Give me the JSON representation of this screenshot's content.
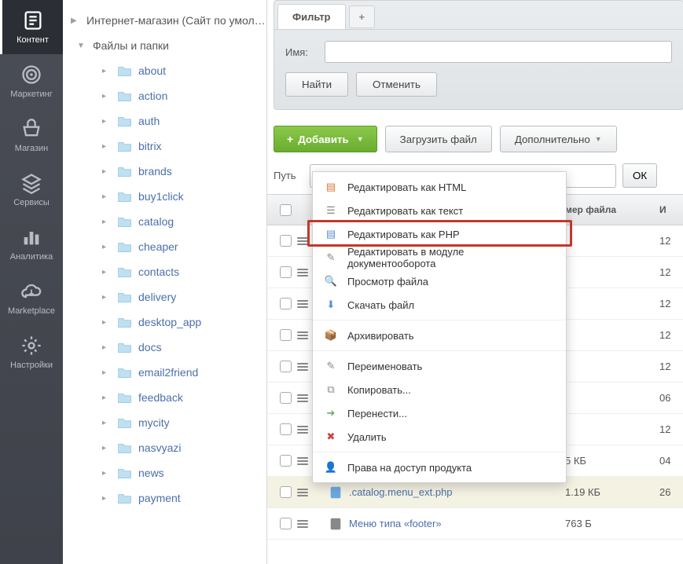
{
  "sidebar": [
    {
      "id": "content",
      "label": "Контент",
      "icon": "doc"
    },
    {
      "id": "marketing",
      "label": "Маркетинг",
      "icon": "target"
    },
    {
      "id": "shop",
      "label": "Магазин",
      "icon": "basket"
    },
    {
      "id": "services",
      "label": "Сервисы",
      "icon": "stack"
    },
    {
      "id": "analytics",
      "label": "Аналитика",
      "icon": "bars"
    },
    {
      "id": "marketplace",
      "label": "Marketplace",
      "icon": "cloud"
    },
    {
      "id": "settings",
      "label": "Настройки",
      "icon": "gear"
    }
  ],
  "tree": {
    "root1": "Интернет-магазин (Сайт по умол…",
    "root2": "Файлы и папки",
    "folders": [
      "about",
      "action",
      "auth",
      "bitrix",
      "brands",
      "buy1click",
      "catalog",
      "cheaper",
      "contacts",
      "delivery",
      "desktop_app",
      "docs",
      "email2friend",
      "feedback",
      "mycity",
      "nasvyazi",
      "news",
      "payment"
    ]
  },
  "filter": {
    "tab": "Фильтр",
    "add": "+",
    "name_label": "Имя:",
    "find": "Найти",
    "cancel": "Отменить"
  },
  "toolbar": {
    "add": "Добавить",
    "upload": "Загрузить файл",
    "more": "Дополнительно"
  },
  "path": {
    "label": "Путь",
    "ok": "ОК"
  },
  "table": {
    "header_size": "мер файла",
    "header_last": "И"
  },
  "rows": [
    {
      "size": "",
      "date": "12"
    },
    {
      "size": "",
      "date": "12"
    },
    {
      "size": "",
      "date": "12"
    },
    {
      "size": "",
      "date": "12"
    },
    {
      "size": "",
      "date": "12"
    },
    {
      "size": "",
      "date": "06"
    },
    {
      "size": "",
      "date": "12"
    },
    {
      "size": "5 КБ",
      "date": "04"
    }
  ],
  "visible_files": [
    {
      "name": ".catalog.menu_ext.php",
      "size": "1.19 КБ",
      "date": "26",
      "icon": "php"
    },
    {
      "name": "Меню типа «footer»",
      "size": "763 Б",
      "date": "",
      "icon": "gear"
    }
  ],
  "context_menu": [
    {
      "label": "Редактировать как HTML",
      "icon": "html",
      "color": "#d87a3e"
    },
    {
      "label": "Редактировать как текст",
      "icon": "txt",
      "color": "#888"
    },
    {
      "label": "Редактировать как PHP",
      "icon": "php",
      "color": "#5a8fd0"
    },
    {
      "label": "Редактировать в модуле документооборота",
      "icon": "docflow",
      "color": "#888"
    },
    {
      "label": "Просмотр файла",
      "icon": "view",
      "color": "#888"
    },
    {
      "label": "Скачать файл",
      "icon": "download",
      "color": "#5a8fd0"
    },
    {
      "sep": true
    },
    {
      "label": "Архивировать",
      "icon": "archive",
      "color": "#c29a5b"
    },
    {
      "sep": true
    },
    {
      "label": "Переименовать",
      "icon": "rename",
      "color": "#888"
    },
    {
      "label": "Копировать...",
      "icon": "copy",
      "color": "#888"
    },
    {
      "label": "Перенести...",
      "icon": "move",
      "color": "#6aa96a"
    },
    {
      "label": "Удалить",
      "icon": "delete",
      "color": "#d04040"
    },
    {
      "sep": true
    },
    {
      "label": "Права на доступ продукта",
      "icon": "perm",
      "color": "#c29a5b"
    }
  ]
}
